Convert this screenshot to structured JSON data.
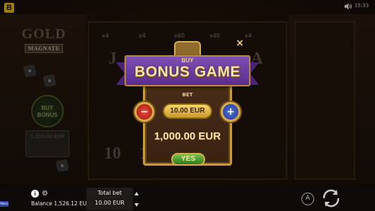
{
  "header": {
    "brand_letter": "B",
    "time": "15:33"
  },
  "game": {
    "logo_word": "GOLD",
    "logo_sub": "MAGNATE",
    "side_buy_bonus": "BUY BONUS",
    "side_balance_value": "1,000.00 EUR"
  },
  "reels": {
    "multipliers": [
      "x4",
      "x4",
      "x60",
      "x40",
      "x4"
    ],
    "symbols": [
      "J",
      "Q",
      "",
      "",
      "A",
      "",
      "",
      "",
      "",
      "",
      "10",
      "10",
      "",
      "",
      ""
    ]
  },
  "bonus_dialog": {
    "buy_label": "BUY",
    "title": "BONUS GAME",
    "bet_label": "BET",
    "bet_value": "10.00 EUR",
    "minus_label": "−",
    "plus_label": "+",
    "price": "1,000.00 EUR",
    "confirm_label": "YES",
    "close_label": "×"
  },
  "footer": {
    "menu_tag": "Menu",
    "info_label": "i",
    "balance_text": "Balance 1,526.12 EUR",
    "total_bet_label": "Total bet",
    "total_bet_value": "10.00 EUR",
    "auto_label": "A"
  },
  "colors": {
    "ribbon_purple": "#6b3aa0",
    "gold": "#d6ad4f",
    "confirm_green": "#4aa032",
    "minus_red": "#c82a1c",
    "plus_blue": "#3450b8"
  }
}
